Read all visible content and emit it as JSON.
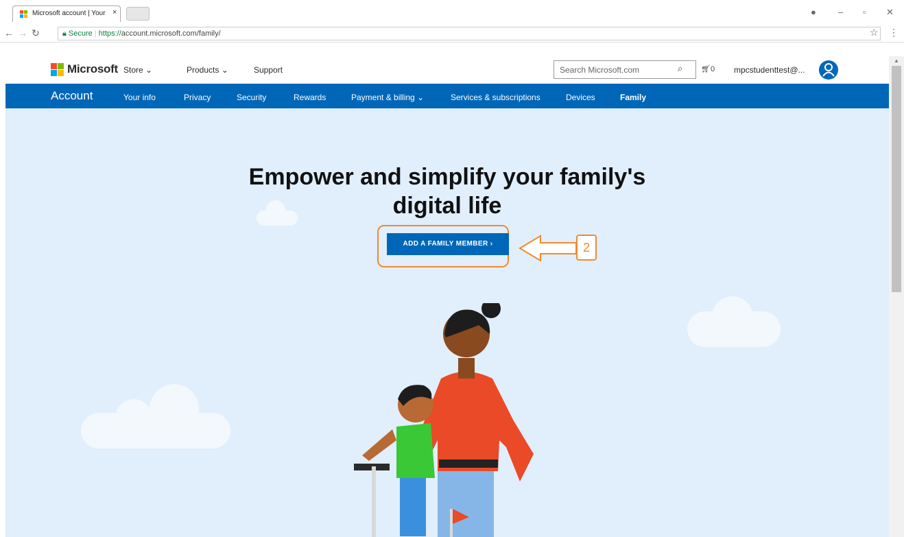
{
  "browser": {
    "tab_title": "Microsoft account | Your",
    "tab_close": "×",
    "url_secure_label": "Secure",
    "url_scheme": "https://",
    "url_rest": "account.microsoft.com/family/"
  },
  "header": {
    "brand": "Microsoft",
    "nav": [
      "Store ⌄",
      "Products ⌄",
      "Support"
    ],
    "search_placeholder": "Search Microsoft.com",
    "cart_count": "0",
    "user": "mpcstudenttest@..."
  },
  "account_nav": {
    "title": "Account",
    "items": [
      "Your info",
      "Privacy",
      "Security",
      "Rewards",
      "Payment & billing ⌄",
      "Services & subscriptions",
      "Devices",
      "Family"
    ]
  },
  "hero": {
    "title_line1": "Empower and simplify your family's",
    "title_line2": "digital life",
    "cta": "ADD A FAMILY MEMBER ›",
    "callout": "2"
  },
  "colors": {
    "accent": "#0067b8",
    "annotation": "#f08a30",
    "page_bg": "#e1eefb"
  }
}
